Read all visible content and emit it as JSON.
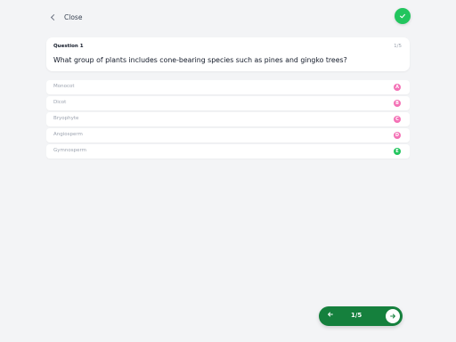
{
  "header": {
    "close_label": "Close"
  },
  "question": {
    "label": "Question 1",
    "counter": "1/5",
    "text": "What group of plants includes cone-bearing species such as pines and gingko trees?"
  },
  "options": [
    {
      "label": "Monocot",
      "badge": "A",
      "badge_color": "#f472b6"
    },
    {
      "label": "Dicot",
      "badge": "B",
      "badge_color": "#f472b6"
    },
    {
      "label": "Bryophyte",
      "badge": "C",
      "badge_color": "#f472b6"
    },
    {
      "label": "Angiosperm",
      "badge": "D",
      "badge_color": "#f472b6"
    },
    {
      "label": "Gymnosperm",
      "badge": "E",
      "badge_color": "#22c55e"
    }
  ],
  "pager": {
    "progress": "1/5"
  },
  "colors": {
    "accent_green": "#15803d",
    "success_green": "#22c55e",
    "badge_pink": "#f472b6"
  },
  "icons": {
    "close": "chevron-left-icon",
    "done": "check-icon",
    "prev": "arrow-left-icon",
    "next": "arrow-right-icon"
  }
}
